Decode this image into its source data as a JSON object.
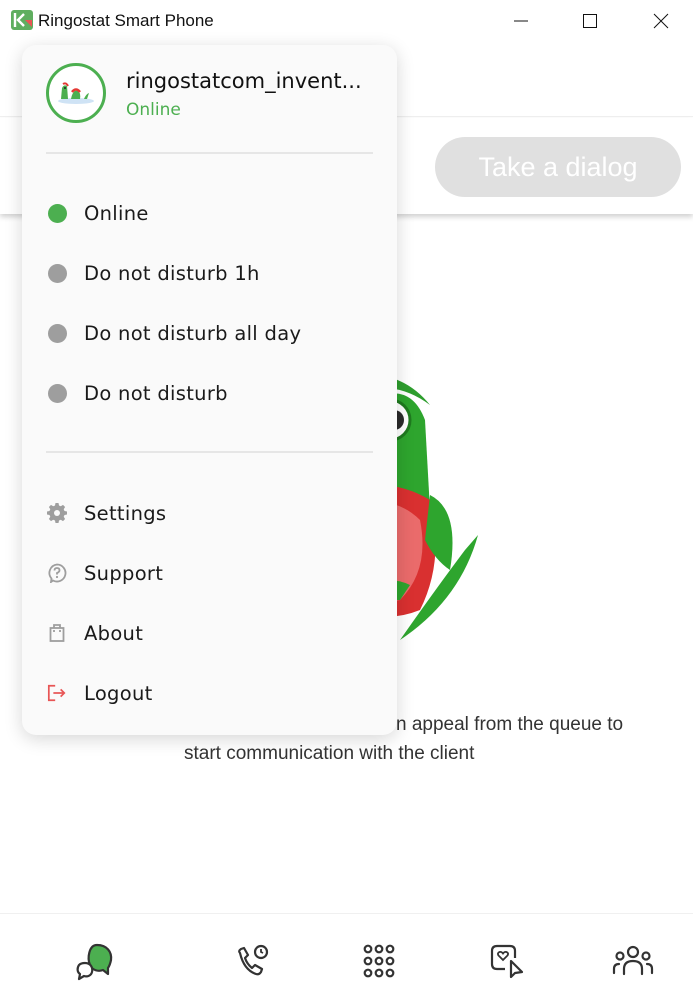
{
  "window": {
    "title": "Ringostat Smart Phone",
    "controls": [
      "minimize",
      "maximize",
      "close"
    ]
  },
  "toolbar": {
    "take_dialog_label": "Take a dialog",
    "take_dialog_enabled": false
  },
  "empty_state": {
    "text_line1_visible": "n appeal from the queue to",
    "text_line2": "start communication with the client"
  },
  "user_menu": {
    "username": "ringostatcom_invent...",
    "status": "Online",
    "statuses": [
      {
        "label": "Online",
        "color": "#4caf50",
        "selected": true
      },
      {
        "label": "Do not disturb 1h",
        "color": "#9e9e9e",
        "selected": false
      },
      {
        "label": "Do not disturb all day",
        "color": "#9e9e9e",
        "selected": false
      },
      {
        "label": "Do not disturb",
        "color": "#9e9e9e",
        "selected": false
      }
    ],
    "actions": [
      {
        "label": "Settings",
        "icon": "gear-icon"
      },
      {
        "label": "Support",
        "icon": "question-bubble-icon"
      },
      {
        "label": "About",
        "icon": "bag-icon"
      },
      {
        "label": "Logout",
        "icon": "logout-icon"
      }
    ]
  },
  "bottom_nav": [
    {
      "name": "chats",
      "icon": "chat-bubbles-icon",
      "active": true
    },
    {
      "name": "call-history",
      "icon": "phone-clock-icon",
      "active": false
    },
    {
      "name": "dialpad",
      "icon": "dialpad-icon",
      "active": false
    },
    {
      "name": "widget",
      "icon": "screen-cursor-icon",
      "active": false
    },
    {
      "name": "contacts",
      "icon": "people-icon",
      "active": false
    }
  ],
  "colors": {
    "accent": "#4caf50",
    "inactive_status": "#9e9e9e",
    "logout": "#e85555",
    "disabled_button": "#e0e0e0"
  }
}
